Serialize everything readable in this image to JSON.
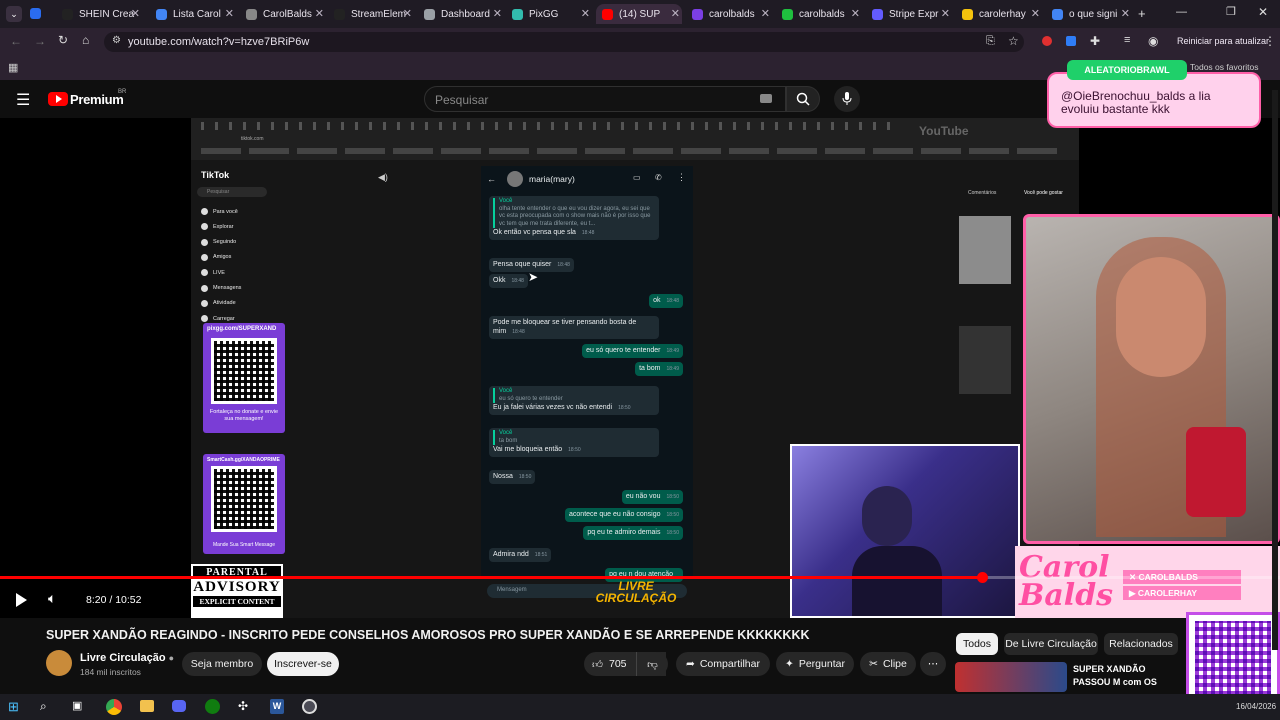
{
  "browser": {
    "tabs": [
      {
        "label": "SHEIN Crea",
        "color": "#222222"
      },
      {
        "label": "Lista Carol",
        "color": "#4285f4"
      },
      {
        "label": "CarolBalds",
        "color": "#888888"
      },
      {
        "label": "StreamElem",
        "color": "#222222"
      },
      {
        "label": "Dashboard",
        "color": "#9aa0a6"
      },
      {
        "label": "PixGG",
        "color": "#32bcad"
      },
      {
        "label": "(14) SUP",
        "color": "#ff0000"
      },
      {
        "label": "carolbalds",
        "color": "#7b3fe4"
      },
      {
        "label": "carolbalds",
        "color": "#1fbf3f"
      },
      {
        "label": "Stripe Expr",
        "color": "#635bff"
      },
      {
        "label": "carolerhay",
        "color": "#f4c20d"
      },
      {
        "label": "o que signi",
        "color": "#4285f4"
      }
    ],
    "url": "youtube.com/watch?v=hzve7BRiP6w",
    "restart_label": "Reiniciar para atualizar",
    "favorites_label": "Todos os favoritos"
  },
  "youtube": {
    "brand": "Premium",
    "region": "BR",
    "search_placeholder": "Pesquisar",
    "video": {
      "time": "8:20 / 10:52",
      "progress": 0.767,
      "title": "SUPER XANDÃO REAGINDO - INSCRITO PEDE CONSELHOS AMOROSOS PRO SUPER XANDÃO E SE ARREPENDE KKKKKKKK"
    },
    "channel": {
      "name": "Livre Circulação",
      "subs": "184 mil inscritos",
      "join_label": "Seja membro",
      "subscribe_label": "Inscrever-se"
    },
    "actions": {
      "likes": "705",
      "share": "Compartilhar",
      "ask": "Perguntar",
      "clip": "Clipe"
    },
    "chips": [
      "Todos",
      "De Livre Circulação",
      "Relacionados"
    ],
    "related": {
      "title": "SUPER XANDÃO PASSOU M com OS PRINTS do INSCRI"
    }
  },
  "stream_overlay": {
    "badge": "ALEATORIOBRAWL",
    "chat_message": "@OieBrenochuu_balds a lia evoluiu bastante kkk",
    "socials": [
      "CAROLBALDS",
      "CAROLERHAY"
    ],
    "logo_text": "Carol Balds"
  },
  "inner_video": {
    "tiktok": {
      "logo": "TikTok",
      "search": "Pesquisar",
      "nav": [
        "Para você",
        "Explorar",
        "Seguindo",
        "Amigos",
        "LIVE",
        "Mensagens",
        "Atividade",
        "Carregar"
      ],
      "tabs": [
        "Comentários",
        "Você pode gostar"
      ]
    },
    "qr_top": {
      "url": "pixgg.com/SUPERXAND",
      "caption": "Fortaleça no donate e envie sua mensagem!"
    },
    "qr_bottom": {
      "url": "SmartCash.gg/XANDAOPRIME",
      "caption": "Mande Sua Smart Message"
    },
    "advisory": [
      "PARENTAL",
      "ADVISORY",
      "EXPLICIT CONTENT"
    ],
    "livre_logo": "LIVRE CIRCULAÇÃO",
    "chat": {
      "contact": "maria(mary)",
      "messages": [
        {
          "dir": "in",
          "quote_author": "Você",
          "quote": "olha tente entender o que eu vou dizer agora, eu sei que vc esta preocupada com o show mais não é por isso que vc tem que me trata diferente, eu t...",
          "text": "Ok então vc pensa que sla",
          "time": "18:48"
        },
        {
          "dir": "in",
          "text": "Pensa oque quiser",
          "time": "18:48"
        },
        {
          "dir": "in",
          "text": "Okk",
          "time": "18:48"
        },
        {
          "dir": "out",
          "text": "ok",
          "time": "18:48"
        },
        {
          "dir": "in",
          "text": "Pode me bloquear se tiver pensando bosta de mim",
          "time": "18:48"
        },
        {
          "dir": "out",
          "text": "eu só quero te entender",
          "time": "18:49"
        },
        {
          "dir": "out",
          "text": "ta bom",
          "time": "18:49"
        },
        {
          "dir": "in",
          "quote_author": "Você",
          "quote": "eu só quero te entender",
          "text": "Eu ja falei várias vezes vc não entendi",
          "time": "18:50"
        },
        {
          "dir": "in",
          "quote_author": "Você",
          "quote": "ta bom",
          "text": "Vai me bloqueia então",
          "time": "18:50"
        },
        {
          "dir": "in",
          "text": "Nossa",
          "time": "18:50"
        },
        {
          "dir": "out",
          "text": "eu não vou",
          "time": "18:50"
        },
        {
          "dir": "out",
          "text": "acontece que eu não consigo",
          "time": "18:50"
        },
        {
          "dir": "out",
          "text": "pq eu te admiro demais",
          "time": "18:50"
        },
        {
          "dir": "in",
          "text": "Admira ndd",
          "time": "18:51"
        },
        {
          "dir": "out",
          "text": "pq eu n dou atenção",
          "time": ""
        }
      ],
      "input_placeholder": "Mensagem"
    }
  },
  "taskbar": {
    "date": "16/04/2026"
  }
}
